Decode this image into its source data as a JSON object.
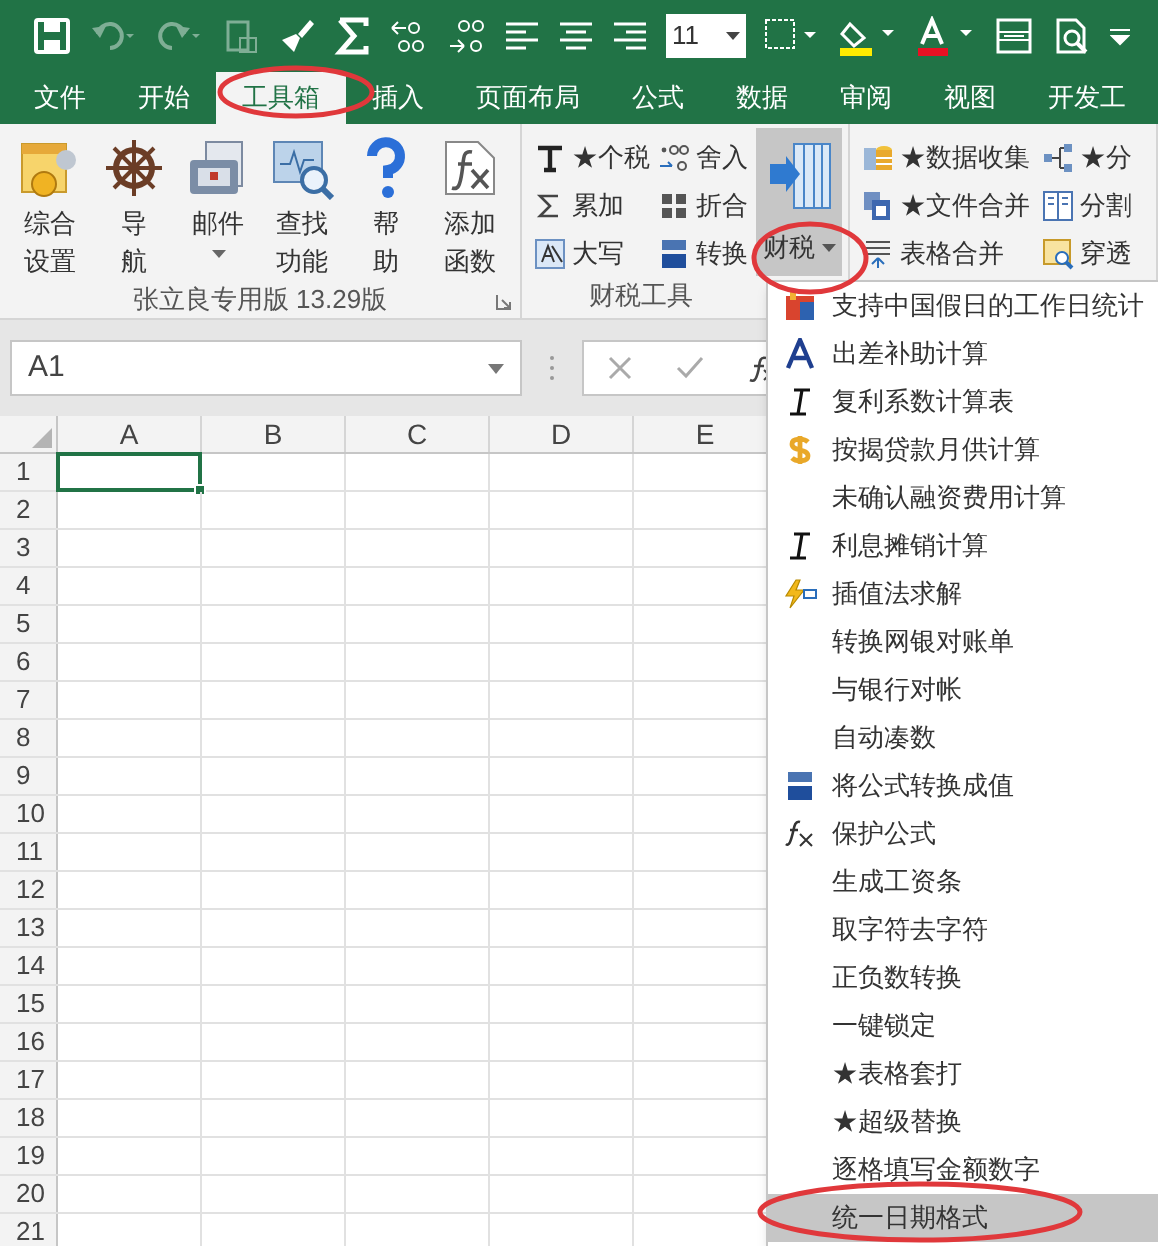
{
  "quick_access": {
    "font_size": "11"
  },
  "tabs": [
    {
      "label": "文件",
      "selected": false
    },
    {
      "label": "开始",
      "selected": false
    },
    {
      "label": "工具箱",
      "selected": true
    },
    {
      "label": "插入",
      "selected": false
    },
    {
      "label": "页面布局",
      "selected": false
    },
    {
      "label": "公式",
      "selected": false
    },
    {
      "label": "数据",
      "selected": false
    },
    {
      "label": "审阅",
      "selected": false
    },
    {
      "label": "视图",
      "selected": false
    },
    {
      "label": "开发工",
      "selected": false
    }
  ],
  "ribbon": {
    "groups": [
      {
        "label": "张立良专用版 13.29版",
        "buttons": [
          {
            "lines": [
              "综合",
              "设置"
            ]
          },
          {
            "lines": [
              "导",
              "航"
            ]
          },
          {
            "lines": [
              "邮件"
            ]
          },
          {
            "lines": [
              "查找",
              "功能"
            ]
          },
          {
            "lines": [
              "帮",
              "助"
            ]
          },
          {
            "lines": [
              "添加",
              "函数"
            ]
          }
        ]
      },
      {
        "label": "财税工具",
        "small_buttons": [
          {
            "label": "★个税"
          },
          {
            "label": "累加"
          },
          {
            "label": "大写"
          },
          {
            "label": "舍入"
          },
          {
            "label": "折合"
          },
          {
            "label": "转换"
          }
        ],
        "big_button": {
          "label": "财税",
          "expanded": true
        }
      },
      {
        "small_buttons": [
          {
            "label": "★数据收集"
          },
          {
            "label": "★文件合并"
          },
          {
            "label": "表格合并"
          },
          {
            "label": "★分"
          },
          {
            "label": "分割"
          },
          {
            "label": "穿透"
          }
        ]
      }
    ]
  },
  "name_box": {
    "value": "A1"
  },
  "sheet": {
    "columns": [
      "A",
      "B",
      "C",
      "D",
      "E"
    ],
    "rows": [
      "1",
      "2",
      "3",
      "4",
      "5",
      "6",
      "7",
      "8",
      "9",
      "10",
      "11",
      "12",
      "13",
      "14",
      "15",
      "16",
      "17",
      "18",
      "19",
      "20",
      "21"
    ]
  },
  "menu": {
    "items": [
      {
        "label": "支持中国假日的工作日统计",
        "selected": false
      },
      {
        "label": "出差补助计算",
        "selected": false
      },
      {
        "label": "复利系数计算表",
        "selected": false
      },
      {
        "label": "按揭贷款月供计算",
        "selected": false
      },
      {
        "label": "未确认融资费用计算",
        "selected": false
      },
      {
        "label": "利息摊销计算",
        "selected": false
      },
      {
        "label": "插值法求解",
        "selected": false
      },
      {
        "label": "转换网银对账单",
        "selected": false
      },
      {
        "label": "与银行对帐",
        "selected": false
      },
      {
        "label": "自动凑数",
        "selected": false
      },
      {
        "label": "将公式转换成值",
        "selected": false
      },
      {
        "label": "保护公式",
        "selected": false
      },
      {
        "label": "生成工资条",
        "selected": false
      },
      {
        "label": "取字符去字符",
        "selected": false
      },
      {
        "label": "正负数转换",
        "selected": false
      },
      {
        "label": "一键锁定",
        "selected": false
      },
      {
        "label": "★表格套打",
        "selected": false
      },
      {
        "label": "★超级替换",
        "selected": false
      },
      {
        "label": "逐格填写金额数字",
        "selected": false
      },
      {
        "label": "统一日期格式",
        "selected": true
      }
    ]
  }
}
